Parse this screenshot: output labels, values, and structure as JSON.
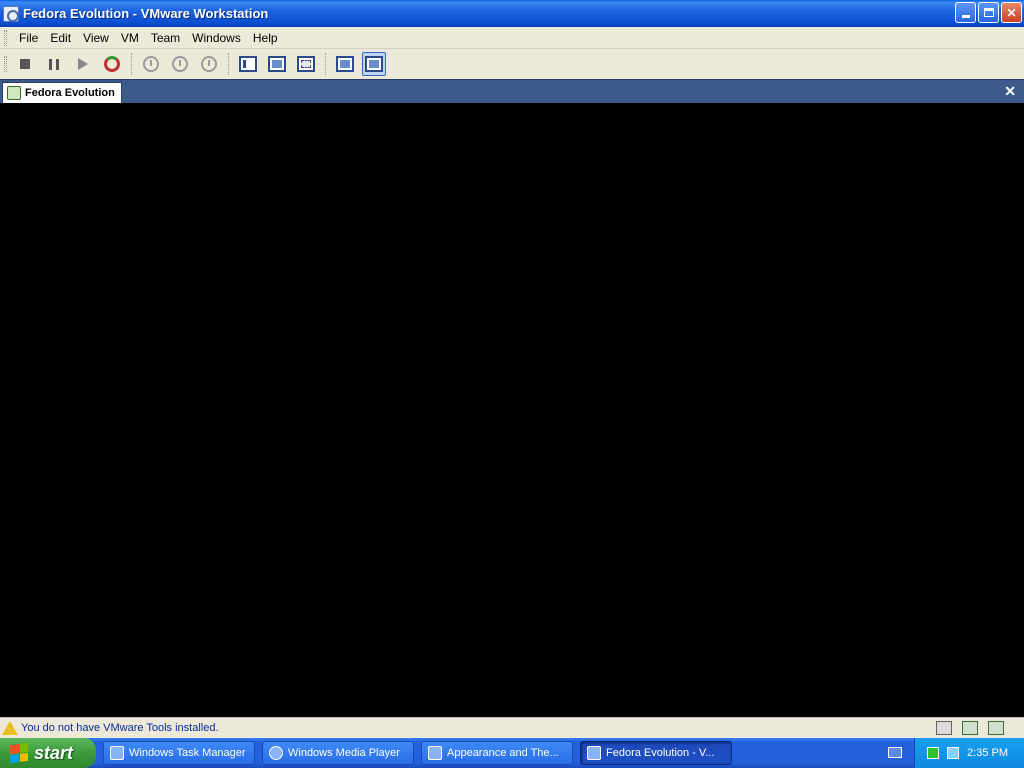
{
  "window": {
    "title": "Fedora Evolution - VMware Workstation"
  },
  "menu": [
    "File",
    "Edit",
    "View",
    "VM",
    "Team",
    "Windows",
    "Help"
  ],
  "toolbar": {
    "icons": [
      "stop-icon",
      "pause-icon",
      "play-icon",
      "reset-icon",
      "snapshot-take-icon",
      "snapshot-revert-icon",
      "snapshot-manager-icon",
      "quick-switch-icon",
      "full-screen-icon",
      "fit-window-icon",
      "console-view-icon",
      "summary-view-icon"
    ]
  },
  "tab": {
    "label": "Fedora Evolution"
  },
  "status": {
    "message": "You do not have VMware Tools installed."
  },
  "taskbar": {
    "start_label": "start",
    "tasks": [
      {
        "label": "Windows Task Manager"
      },
      {
        "label": "Windows Media Player"
      },
      {
        "label": "Appearance and The..."
      },
      {
        "label": "Fedora Evolution - V..."
      }
    ],
    "clock": "2:35 PM"
  },
  "colors": {
    "titlebar": "#0b4fd0",
    "chrome": "#ece9d8",
    "tabstrip": "#3d5a8a",
    "vm_screen": "#000000",
    "taskbar": "#245edb",
    "start_button": "#3c9a3c"
  }
}
